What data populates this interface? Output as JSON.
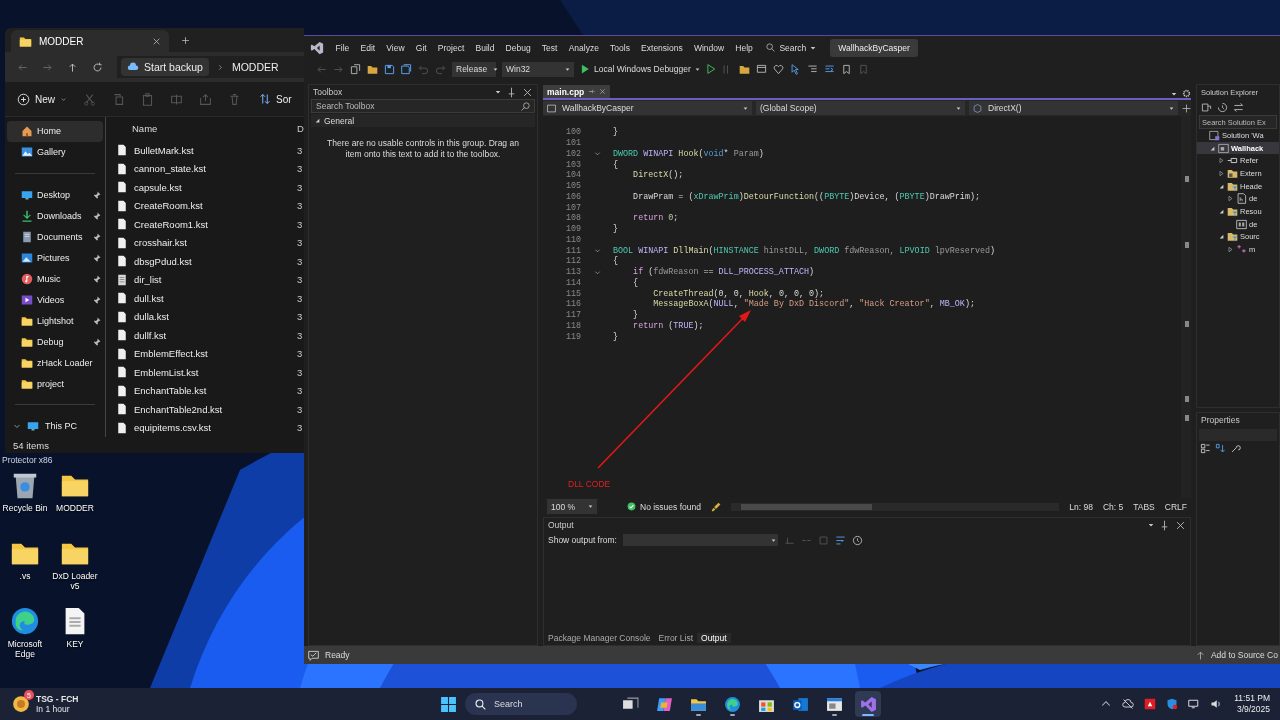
{
  "desktop": {
    "partial_label": "Protector x86",
    "icons": [
      {
        "label": "Recycle Bin",
        "kind": "bin"
      },
      {
        "label": "MODDER",
        "kind": "folder"
      },
      {
        "label": ".vs",
        "kind": "folder"
      },
      {
        "label": "DxD Loader v5",
        "kind": "folder"
      },
      {
        "label": "Microsoft Edge",
        "kind": "edge"
      },
      {
        "label": "KEY",
        "kind": "document"
      }
    ]
  },
  "explorer": {
    "tab_title": "MODDER",
    "breadcrumb": [
      "Start backup",
      "MODDER"
    ],
    "new_button": "New",
    "sort_button": "Sor",
    "nav_top": [
      {
        "label": "Home",
        "kind": "home",
        "selected": true
      },
      {
        "label": "Gallery",
        "kind": "gallery",
        "selected": false
      }
    ],
    "quick_access": [
      {
        "label": "Desktop",
        "kind": "desktop",
        "pinned": true,
        "selected": false
      },
      {
        "label": "Downloads",
        "kind": "download",
        "pinned": true,
        "selected": false
      },
      {
        "label": "Documents",
        "kind": "documents",
        "pinned": true,
        "selected": false
      },
      {
        "label": "Pictures",
        "kind": "pictures",
        "pinned": true,
        "selected": false
      },
      {
        "label": "Music",
        "kind": "music",
        "pinned": true,
        "selected": false
      },
      {
        "label": "Videos",
        "kind": "videos",
        "pinned": true,
        "selected": false
      },
      {
        "label": "Lightshot",
        "kind": "folder",
        "pinned": true,
        "selected": false
      },
      {
        "label": "Debug",
        "kind": "folder",
        "pinned": true,
        "selected": false
      },
      {
        "label": "zHack Loader",
        "kind": "folder",
        "pinned": false,
        "selected": false
      },
      {
        "label": "project",
        "kind": "folder",
        "pinned": false,
        "selected": false
      }
    ],
    "this_pc": {
      "label": "This PC",
      "expanded": true
    },
    "columns": [
      "Name",
      "D"
    ],
    "files": [
      {
        "name": "BulletMark.kst",
        "kind": "file",
        "column_2": "3"
      },
      {
        "name": "cannon_state.kst",
        "kind": "file",
        "column_2": "3"
      },
      {
        "name": "capsule.kst",
        "kind": "file",
        "column_2": "3"
      },
      {
        "name": "CreateRoom.kst",
        "kind": "file",
        "column_2": "3"
      },
      {
        "name": "CreateRoom1.kst",
        "kind": "file",
        "column_2": "3"
      },
      {
        "name": "crosshair.kst",
        "kind": "file",
        "column_2": "3"
      },
      {
        "name": "dbsgPdud.kst",
        "kind": "file",
        "column_2": "3"
      },
      {
        "name": "dir_list",
        "kind": "text",
        "column_2": "3"
      },
      {
        "name": "dull.kst",
        "kind": "file",
        "column_2": "3"
      },
      {
        "name": "dulla.kst",
        "kind": "file",
        "column_2": "3"
      },
      {
        "name": "dullf.kst",
        "kind": "file",
        "column_2": "3"
      },
      {
        "name": "EmblemEffect.kst",
        "kind": "file",
        "column_2": "3"
      },
      {
        "name": "EmblemList.kst",
        "kind": "file",
        "column_2": "3"
      },
      {
        "name": "EnchantTable.kst",
        "kind": "file",
        "column_2": "3"
      },
      {
        "name": "EnchantTable2nd.kst",
        "kind": "file",
        "column_2": "3"
      },
      {
        "name": "equipitems.csv.kst",
        "kind": "file",
        "column_2": "3"
      }
    ],
    "status": "54 items"
  },
  "vs": {
    "menu": [
      "File",
      "Edit",
      "View",
      "Git",
      "Project",
      "Build",
      "Debug",
      "Test",
      "Analyze",
      "Tools",
      "Extensions",
      "Window",
      "Help"
    ],
    "search": "Search",
    "solution_title": "WallhackByCasper",
    "toolbar": {
      "configuration": "Release",
      "platform": "Win32",
      "debugger": "Local Windows Debugger"
    },
    "toolbox": {
      "title": "Toolbox",
      "search_placeholder": "Search Toolbox",
      "group": {
        "label": "General",
        "expanded": true
      },
      "message": "There are no usable controls in this group. Drag an item onto this text to add it to the toolbox."
    },
    "editor": {
      "tabs": [
        {
          "label": "main.cpp",
          "selected": true
        }
      ],
      "nav": [
        "WallhackByCasper",
        "(Global Scope)",
        "DirectX()"
      ],
      "lines": [
        {
          "number": "100",
          "kind": "code",
          "tokens": [
            {
              "text": "}",
              "kind": "plain"
            }
          ]
        },
        {
          "number": "101",
          "kind": "code"
        },
        {
          "number": "102",
          "kind": "fold",
          "tokens": [
            {
              "text": "DWORD",
              "kind": "type"
            },
            {
              "text": " WINAPI ",
              "kind": "macro"
            },
            {
              "text": "Hook",
              "kind": "func"
            },
            {
              "text": "(",
              "kind": "plain"
            },
            {
              "text": "void",
              "kind": "keyword"
            },
            {
              "text": "* ",
              "kind": "plain"
            },
            {
              "text": "Param",
              "kind": "param"
            },
            {
              "text": ")",
              "kind": "plain"
            }
          ]
        },
        {
          "number": "103",
          "kind": "code",
          "tokens": [
            {
              "text": "{",
              "kind": "plain"
            }
          ]
        },
        {
          "number": "104",
          "kind": "code",
          "tokens": [
            {
              "text": "    DirectX",
              "kind": "func"
            },
            {
              "text": "();",
              "kind": "plain"
            }
          ]
        },
        {
          "number": "105",
          "kind": "code"
        },
        {
          "number": "106",
          "kind": "code",
          "tokens": [
            {
              "text": "    DrawPram = (",
              "kind": "plain"
            },
            {
              "text": "xDrawPrim",
              "kind": "type"
            },
            {
              "text": ")",
              "kind": "plain"
            },
            {
              "text": "DetourFunction",
              "kind": "func"
            },
            {
              "text": "((",
              "kind": "plain"
            },
            {
              "text": "PBYTE",
              "kind": "type"
            },
            {
              "text": ")Device, (",
              "kind": "plain"
            },
            {
              "text": "PBYTE",
              "kind": "type"
            },
            {
              "text": ")DrawPrim);",
              "kind": "plain"
            }
          ]
        },
        {
          "number": "107",
          "kind": "code"
        },
        {
          "number": "108",
          "kind": "code",
          "tokens": [
            {
              "text": "    return ",
              "kind": "control"
            },
            {
              "text": "0",
              "kind": "number"
            },
            {
              "text": ";",
              "kind": "plain"
            }
          ]
        },
        {
          "number": "109",
          "kind": "code",
          "tokens": [
            {
              "text": "}",
              "kind": "plain"
            }
          ]
        },
        {
          "number": "110",
          "kind": "code"
        },
        {
          "number": "111",
          "kind": "fold",
          "tokens": [
            {
              "text": "BOOL",
              "kind": "type"
            },
            {
              "text": " WINAPI ",
              "kind": "macro"
            },
            {
              "text": "DllMain",
              "kind": "func"
            },
            {
              "text": "(",
              "kind": "plain"
            },
            {
              "text": "HINSTANCE",
              "kind": "type"
            },
            {
              "text": " hinstDLL, ",
              "kind": "param"
            },
            {
              "text": "DWORD",
              "kind": "type"
            },
            {
              "text": " fdwReason, ",
              "kind": "param"
            },
            {
              "text": "LPVOID",
              "kind": "type"
            },
            {
              "text": " lpvReserved",
              "kind": "param"
            },
            {
              "text": ")",
              "kind": "plain"
            }
          ]
        },
        {
          "number": "112",
          "kind": "code",
          "tokens": [
            {
              "text": "{",
              "kind": "plain"
            }
          ]
        },
        {
          "number": "113",
          "kind": "fold",
          "tokens": [
            {
              "text": "    if",
              "kind": "control"
            },
            {
              "text": " (",
              "kind": "plain"
            },
            {
              "text": "fdwReason",
              "kind": "param"
            },
            {
              "text": " == ",
              "kind": "plain"
            },
            {
              "text": "DLL_PROCESS_ATTACH",
              "kind": "macro"
            },
            {
              "text": ")",
              "kind": "plain"
            }
          ]
        },
        {
          "number": "114",
          "kind": "code",
          "tokens": [
            {
              "text": "    {",
              "kind": "plain"
            }
          ]
        },
        {
          "number": "115",
          "kind": "code",
          "tokens": [
            {
              "text": "        CreateThread",
              "kind": "func"
            },
            {
              "text": "(0, 0, ",
              "kind": "plain"
            },
            {
              "text": "Hook",
              "kind": "func"
            },
            {
              "text": ", 0, 0, 0);",
              "kind": "plain"
            }
          ]
        },
        {
          "number": "116",
          "kind": "code",
          "tokens": [
            {
              "text": "        MessageBoxA",
              "kind": "func"
            },
            {
              "text": "(",
              "kind": "plain"
            },
            {
              "text": "NULL",
              "kind": "macro"
            },
            {
              "text": ", ",
              "kind": "plain"
            },
            {
              "text": "\"Made By DxD Discord\"",
              "kind": "string"
            },
            {
              "text": ", ",
              "kind": "plain"
            },
            {
              "text": "\"Hack Creator\"",
              "kind": "string"
            },
            {
              "text": ", ",
              "kind": "plain"
            },
            {
              "text": "MB_OK",
              "kind": "macro"
            },
            {
              "text": ");",
              "kind": "plain"
            }
          ]
        },
        {
          "number": "117",
          "kind": "code",
          "tokens": [
            {
              "text": "    }",
              "kind": "plain"
            }
          ]
        },
        {
          "number": "118",
          "kind": "code",
          "tokens": [
            {
              "text": "    return",
              "kind": "control"
            },
            {
              "text": " (",
              "kind": "plain"
            },
            {
              "text": "TRUE",
              "kind": "macro"
            },
            {
              "text": ");",
              "kind": "plain"
            }
          ]
        },
        {
          "number": "119",
          "kind": "code",
          "tokens": [
            {
              "text": "}",
              "kind": "plain"
            }
          ]
        }
      ],
      "annotation": "DLL CODE",
      "status": {
        "zoom": "100 %",
        "issues": "No issues found",
        "line": "Ln: 98",
        "column": "Ch: 5",
        "indent": "TABS",
        "eol": "CRLF"
      }
    },
    "output": {
      "title": "Output",
      "source_label": "Show output from:",
      "tabs": [
        {
          "label": "Package Manager Console",
          "selected": false
        },
        {
          "label": "Error List",
          "selected": false
        },
        {
          "label": "Output",
          "selected": true
        }
      ]
    },
    "solution_explorer": {
      "title": "Solution Explorer",
      "search_placeholder": "Search Solution Ex",
      "tree": [
        {
          "label": "Solution 'Wa",
          "kind": "solution",
          "selected": false,
          "children": [
            {
              "label": "Wallhack",
              "kind": "project",
              "selected": true,
              "expanded": true,
              "children": [
                {
                  "label": "Refer",
                  "kind": "references",
                  "selected": false,
                  "expanded": false
                },
                {
                  "label": "Extern",
                  "kind": "external",
                  "selected": false,
                  "expanded": false
                },
                {
                  "label": "Heade",
                  "kind": "filter",
                  "selected": false,
                  "expanded": true,
                  "children": [
                    {
                      "label": "de",
                      "kind": "header",
                      "selected": false,
                      "expanded": false
                    }
                  ]
                },
                {
                  "label": "Resou",
                  "kind": "filter",
                  "selected": false,
                  "expanded": true,
                  "children": [
                    {
                      "label": "de",
                      "kind": "resource",
                      "selected": false
                    }
                  ]
                },
                {
                  "label": "Sourc",
                  "kind": "filter",
                  "selected": false,
                  "expanded": true,
                  "children": [
                    {
                      "label": "m",
                      "kind": "source",
                      "selected": false,
                      "expanded": false
                    }
                  ]
                }
              ]
            }
          ]
        }
      ]
    },
    "properties": {
      "title": "Properties"
    },
    "status_bar": {
      "state": "Ready",
      "source_control": "Add to Source Co"
    }
  },
  "taskbar": {
    "notification": {
      "title": "TSG - FCH",
      "subtitle": "In 1 hour",
      "badge": "5"
    },
    "search_placeholder": "Search",
    "apps": [
      {
        "kind": "taskview",
        "running": false,
        "selected": false
      },
      {
        "kind": "copilot",
        "running": false,
        "selected": false
      },
      {
        "kind": "explorer",
        "running": true,
        "selected": false
      },
      {
        "kind": "edge",
        "running": true,
        "selected": false
      },
      {
        "kind": "store",
        "running": false,
        "selected": false
      },
      {
        "kind": "outlook",
        "running": false,
        "selected": false
      },
      {
        "kind": "app",
        "running": true,
        "selected": false
      },
      {
        "kind": "vs",
        "running": true,
        "selected": true
      }
    ],
    "tray": [
      {
        "kind": "chevron"
      },
      {
        "kind": "cloud"
      },
      {
        "kind": "amd"
      },
      {
        "kind": "shield"
      },
      {
        "kind": "network"
      },
      {
        "kind": "volume"
      }
    ],
    "time": "11:51 PM",
    "date": "3/9/2025"
  }
}
